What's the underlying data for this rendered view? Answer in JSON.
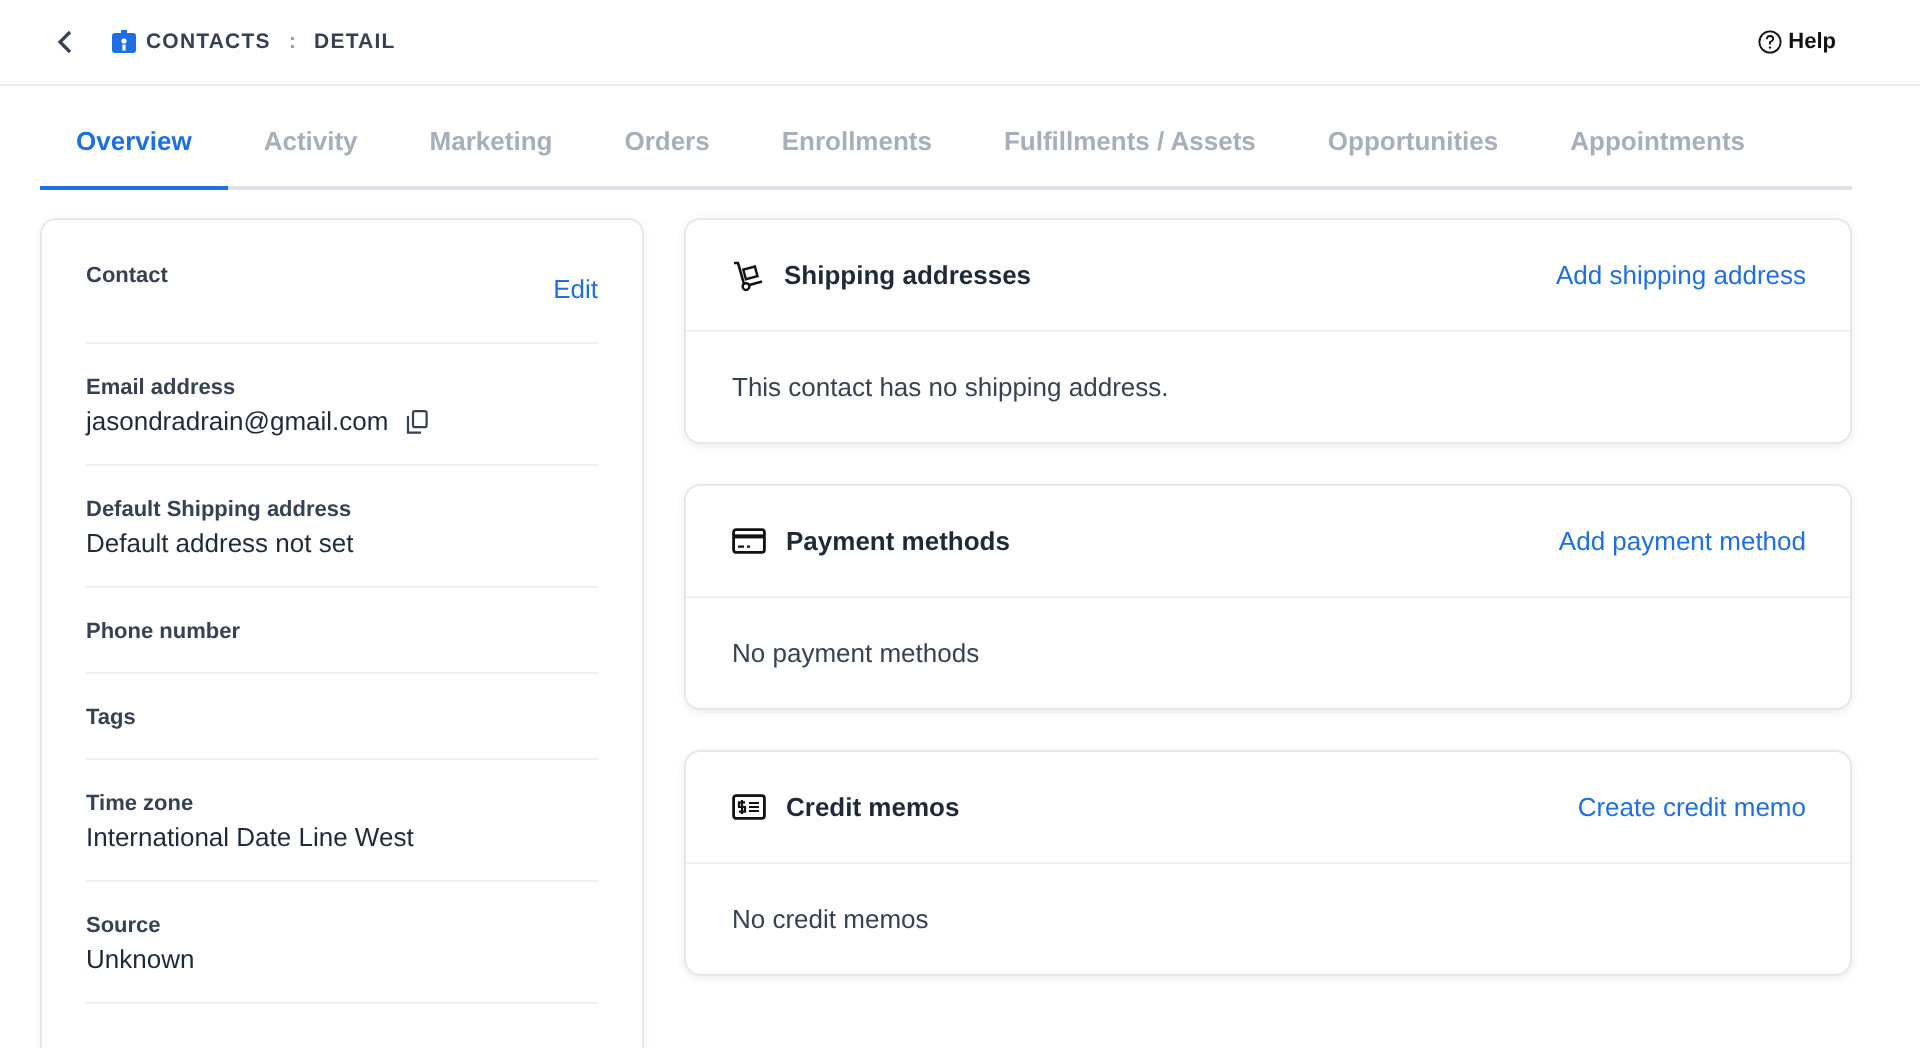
{
  "breadcrumb": {
    "section": "CONTACTS",
    "separator": ":",
    "page": "DETAIL"
  },
  "help": "Help",
  "tabs": [
    {
      "label": "Overview",
      "selected": true
    },
    {
      "label": "Activity",
      "selected": false
    },
    {
      "label": "Marketing",
      "selected": false
    },
    {
      "label": "Orders",
      "selected": false
    },
    {
      "label": "Enrollments",
      "selected": false
    },
    {
      "label": "Fulfillments / Assets",
      "selected": false
    },
    {
      "label": "Opportunities",
      "selected": false
    },
    {
      "label": "Appointments",
      "selected": false
    }
  ],
  "contact": {
    "title": "Contact",
    "edit": "Edit",
    "fields": [
      {
        "label": "Email address",
        "value": "jasondradrain@gmail.com",
        "copyable": true
      },
      {
        "label": "Default Shipping address",
        "value": "Default address not set",
        "copyable": false
      },
      {
        "label": "Phone number"
      },
      {
        "label": "Tags"
      },
      {
        "label": "Time zone",
        "value": "International Date Line West",
        "copyable": false
      },
      {
        "label": "Source",
        "value": "Unknown",
        "copyable": false
      }
    ]
  },
  "cards": [
    {
      "kind": "shipping",
      "title": "Shipping addresses",
      "action": "Add shipping address",
      "empty": "This contact has no shipping address."
    },
    {
      "kind": "payment",
      "title": "Payment methods",
      "action": "Add payment method",
      "empty": "No payment methods"
    },
    {
      "kind": "credit",
      "title": "Credit memos",
      "action": "Create credit memo",
      "empty": "No credit memos"
    }
  ]
}
